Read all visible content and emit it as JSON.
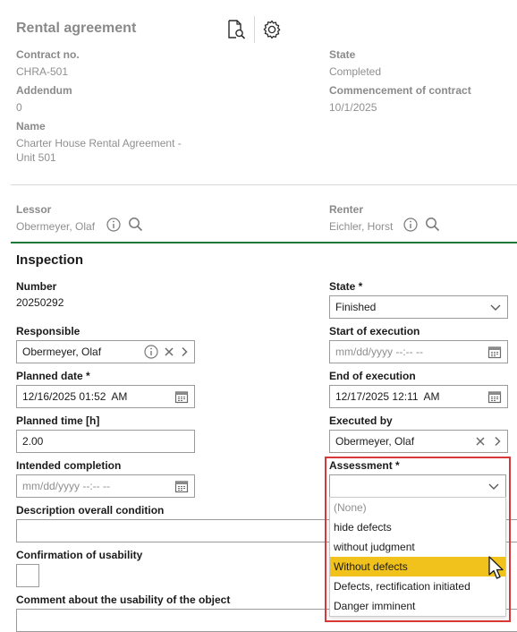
{
  "header": {
    "title": "Rental agreement",
    "preview_icon": "document-search-icon",
    "settings_icon": "gear-icon"
  },
  "contract": {
    "contract_no_label": "Contract no.",
    "contract_no": "CHRA-501",
    "state_label": "State",
    "state": "Completed",
    "addendum_label": "Addendum",
    "addendum": "0",
    "commencement_label": "Commencement of contract",
    "commencement": "10/1/2025",
    "name_label": "Name",
    "name_line1": "Charter House Rental Agreement -",
    "name_line2": "Unit 501",
    "lessor_label": "Lessor",
    "lessor": "Obermeyer, Olaf",
    "renter_label": "Renter",
    "renter": "Eichler, Horst"
  },
  "inspection": {
    "title": "Inspection",
    "number_label": "Number",
    "number": "20250292",
    "state_label": "State *",
    "state_value": "Finished",
    "responsible_label": "Responsible",
    "responsible_value": "Obermeyer, Olaf",
    "start_label": "Start of execution",
    "start_placeholder": "mm/dd/yyyy --:-- --",
    "planned_date_label": "Planned date *",
    "planned_date_value": "12/16/2025 01:52  AM",
    "end_label": "End of execution",
    "end_value": "12/17/2025 12:11  AM",
    "planned_time_label": "Planned time [h]",
    "planned_time_value": "2.00",
    "executed_by_label": "Executed by",
    "executed_by_value": "Obermeyer, Olaf",
    "intended_label": "Intended completion",
    "intended_placeholder": "mm/dd/yyyy --:-- --",
    "assessment_label": "Assessment *",
    "assessment_value": "",
    "description_label": "Description overall condition",
    "confirmation_label": "Confirmation of usability",
    "comment_label": "Comment about the usability of the object"
  },
  "assessment_options": [
    "(None)",
    "hide defects",
    "without judgment",
    "Without defects",
    "Defects, rectification initiated",
    "Danger imminent"
  ],
  "colors": {
    "highlight": "#f0c21b",
    "section_rule": "#1f7a3a",
    "focus_outline": "#d9383a"
  }
}
